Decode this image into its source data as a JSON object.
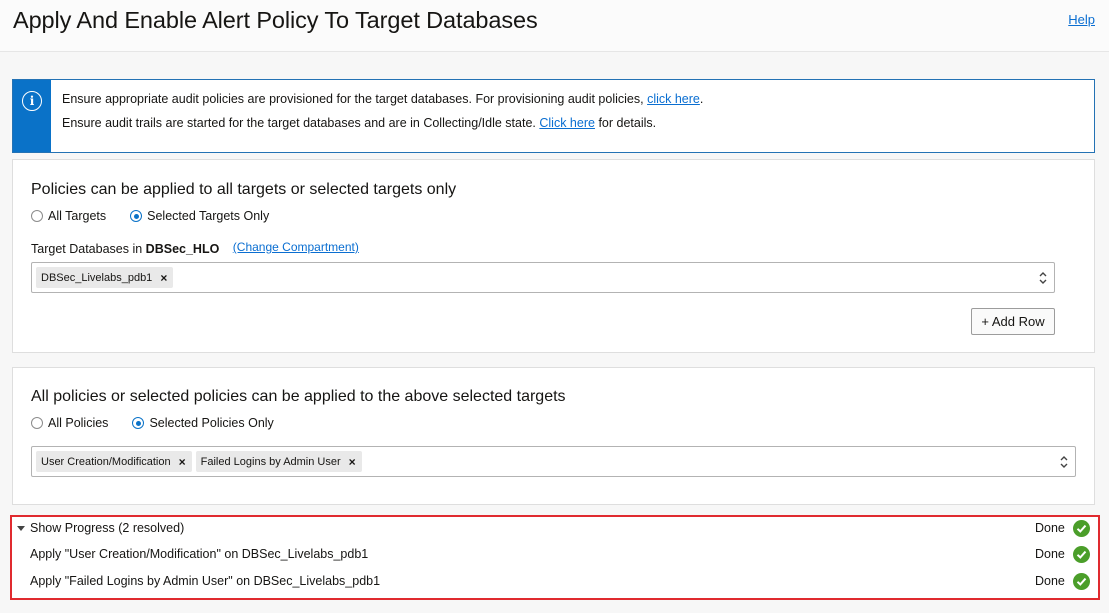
{
  "header": {
    "title": "Apply And Enable Alert Policy To Target Databases",
    "help_label": "Help"
  },
  "info": {
    "line1_text": "Ensure appropriate audit policies are provisioned for the target databases. For provisioning audit policies,",
    "line1_link": "click here",
    "line1_end": ".",
    "line2_text": "Ensure audit trails are started for the target databases and are in Collecting/Idle state.",
    "line2_link": "Click here",
    "line2_end": "for details.",
    "icon": "info-icon"
  },
  "targets": {
    "title": "Policies can be applied to all targets or selected targets only",
    "radio_all": "All Targets",
    "radio_selected": "Selected Targets Only",
    "selected_option": "Selected Targets Only",
    "field_label_prefix": "Target Databases in",
    "compartment": "DBSec_HLO",
    "change_compartment": "(Change Compartment)",
    "chips": [
      "DBSec_Livelabs_pdb1"
    ],
    "add_row_label": "+ Add Row"
  },
  "policies": {
    "title": "All policies or selected policies can be applied to the above selected targets",
    "radio_all": "All Policies",
    "radio_selected": "Selected Policies Only",
    "selected_option": "Selected Policies Only",
    "chips": [
      "User Creation/Modification",
      "Failed Logins by Admin User"
    ]
  },
  "progress": {
    "header": "Show Progress (2 resolved)",
    "rows": [
      {
        "text": "Show Progress (2 resolved)",
        "status": "Done"
      },
      {
        "text": "Apply \"User Creation/Modification\" on DBSec_Livelabs_pdb1",
        "status": "Done"
      },
      {
        "text": "Apply \"Failed Logins by Admin User\" on DBSec_Livelabs_pdb1",
        "status": "Done"
      }
    ]
  },
  "colors": {
    "accent": "#0a72c8",
    "link": "#0a6ed1",
    "success": "#4b9e2a",
    "highlight_border": "#e02a2f"
  }
}
